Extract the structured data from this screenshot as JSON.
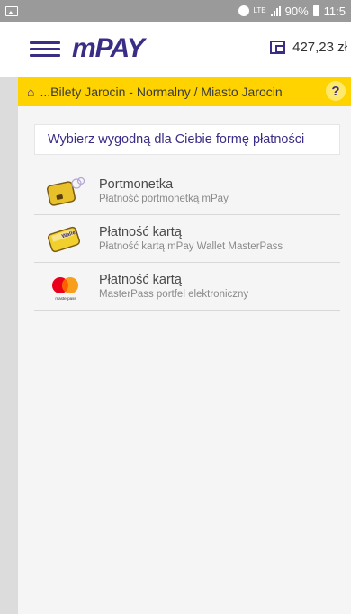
{
  "status": {
    "lte": "LTE",
    "battery": "90%",
    "time": "11:5"
  },
  "header": {
    "logo": "mPAY",
    "balance": "427,23 zł"
  },
  "breadcrumb": {
    "text": "...Bilety Jarocin - Normalny / Miasto Jarocin",
    "help": "?"
  },
  "main": {
    "choose": "Wybierz wygodną dla Ciebie formę płatności",
    "options": [
      {
        "title": "Portmonetka",
        "subtitle": "Płatność portmonetką mPay",
        "icon": "purse-icon"
      },
      {
        "title": "Płatność kartą",
        "subtitle": "Płatność kartą mPay Wallet MasterPass",
        "icon": "wallet-card-icon",
        "card_text": "Wallet"
      },
      {
        "title": "Płatność kartą",
        "subtitle": "MasterPass portfel elektroniczny",
        "icon": "masterpass-icon",
        "logo_text": "masterpass"
      }
    ]
  },
  "colors": {
    "brand": "#3a2d86",
    "accent_yellow": "#ffd300",
    "mc_red": "#eb001b",
    "mc_orange": "#f79e1b"
  }
}
